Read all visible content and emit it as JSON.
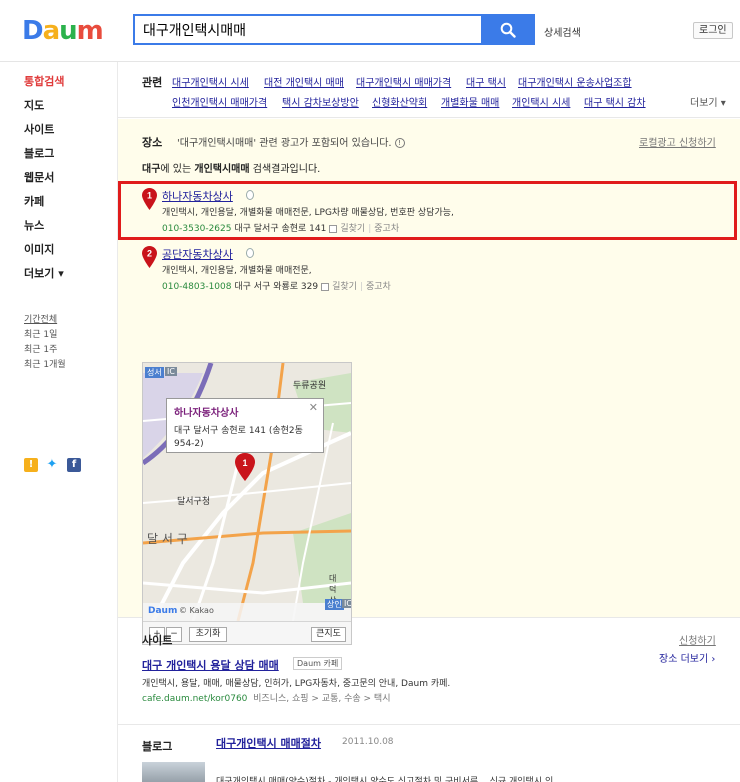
{
  "header": {
    "logo": "Daum",
    "search_value": "대구개인택시매매",
    "detail_search": "상세검색",
    "login": "로그인"
  },
  "sidebar": {
    "items": [
      {
        "label": "통합검색",
        "active": true
      },
      {
        "label": "지도"
      },
      {
        "label": "사이트"
      },
      {
        "label": "블로그"
      },
      {
        "label": "웹문서"
      },
      {
        "label": "카페"
      },
      {
        "label": "뉴스"
      },
      {
        "label": "이미지"
      },
      {
        "label": "더보기 ▾"
      }
    ],
    "period_title": "기간전체",
    "period_items": [
      "최근 1일",
      "최근 1주",
      "최근 1개월"
    ]
  },
  "related": {
    "label": "관련",
    "row1": [
      "대구개인택시 시세",
      "대전 개인택시 매매",
      "대구개인택시 매매가격",
      "대구 택시",
      "대구개인택시 운송사업조합"
    ],
    "row2": [
      "인천개인택시 매매가격",
      "택시 감차보상방안",
      "신형화산약회",
      "개별화물 매매",
      "개인택시 시세",
      "대구 택시 감차"
    ],
    "more": "더보기 ▾"
  },
  "place": {
    "title": "장소",
    "notice": "'대구개인택시매매' 관련 광고가 포함되어 있습니다.",
    "apply": "로컬광고 신청하기",
    "desc_region": "대구",
    "desc_mid": "에 있는 ",
    "desc_query": "개인택시매매",
    "desc_end": " 검색결과입니다.",
    "results": [
      {
        "num": "1",
        "name": "하나자동차상사",
        "categories": "개인택시, 개인용달, 개별화물 매매전문, LPG차량 매물상담, 번호판 상담가능,",
        "phone": "010-3530-2625",
        "address": "대구 달서구 송현로 141",
        "directions": "길찾기",
        "category_tag": "중고차"
      },
      {
        "num": "2",
        "name": "공단자동차상사",
        "categories": "개인택시, 개인용달, 개별화물 매매전문,",
        "phone": "010-4803-1008",
        "address": "대구 서구 와룡로 329",
        "directions": "길찾기",
        "category_tag": "중고차"
      }
    ],
    "map": {
      "popup_name": "하나자동차상사",
      "popup_addr": "대구 달서구 송현로 141 (송현2동 954-2)",
      "labels": {
        "seongseo": "성서",
        "ic": "IC",
        "duryu": "두류공원",
        "dalseogu_office": "달서구청",
        "dalseogu": "달 서 구",
        "daeduk": "대덕산",
        "sangin": "상인",
        "ic2": "IC",
        "kakao": "© Kakao",
        "daum": "Daum"
      },
      "zoom_in": "+",
      "zoom_out": "−",
      "reset": "초기화",
      "big_map": "큰지도"
    },
    "more": "장소 더보기 ›"
  },
  "site": {
    "title": "사이트",
    "apply": "신청하기",
    "link": "대구 개인택시 용달 상담 매매",
    "badge": "Daum 카페",
    "desc": "개인택시, 용달, 매매, 매물상담, 인허가, LPG자동차, 중고문의 안내, Daum 카페.",
    "url": "cafe.daum.net/kor0760",
    "category": "비즈니스, 쇼핑 > 교통, 수송 > 택시"
  },
  "blog": {
    "title": "블로그",
    "link": "대구개인택시 매매절차",
    "date": "2011.10.08",
    "excerpt": "대구개인택시 매매(양수)절차 - 개인택시 양수도 신고절차 및 구비서류... 신규 개인택시 인"
  }
}
